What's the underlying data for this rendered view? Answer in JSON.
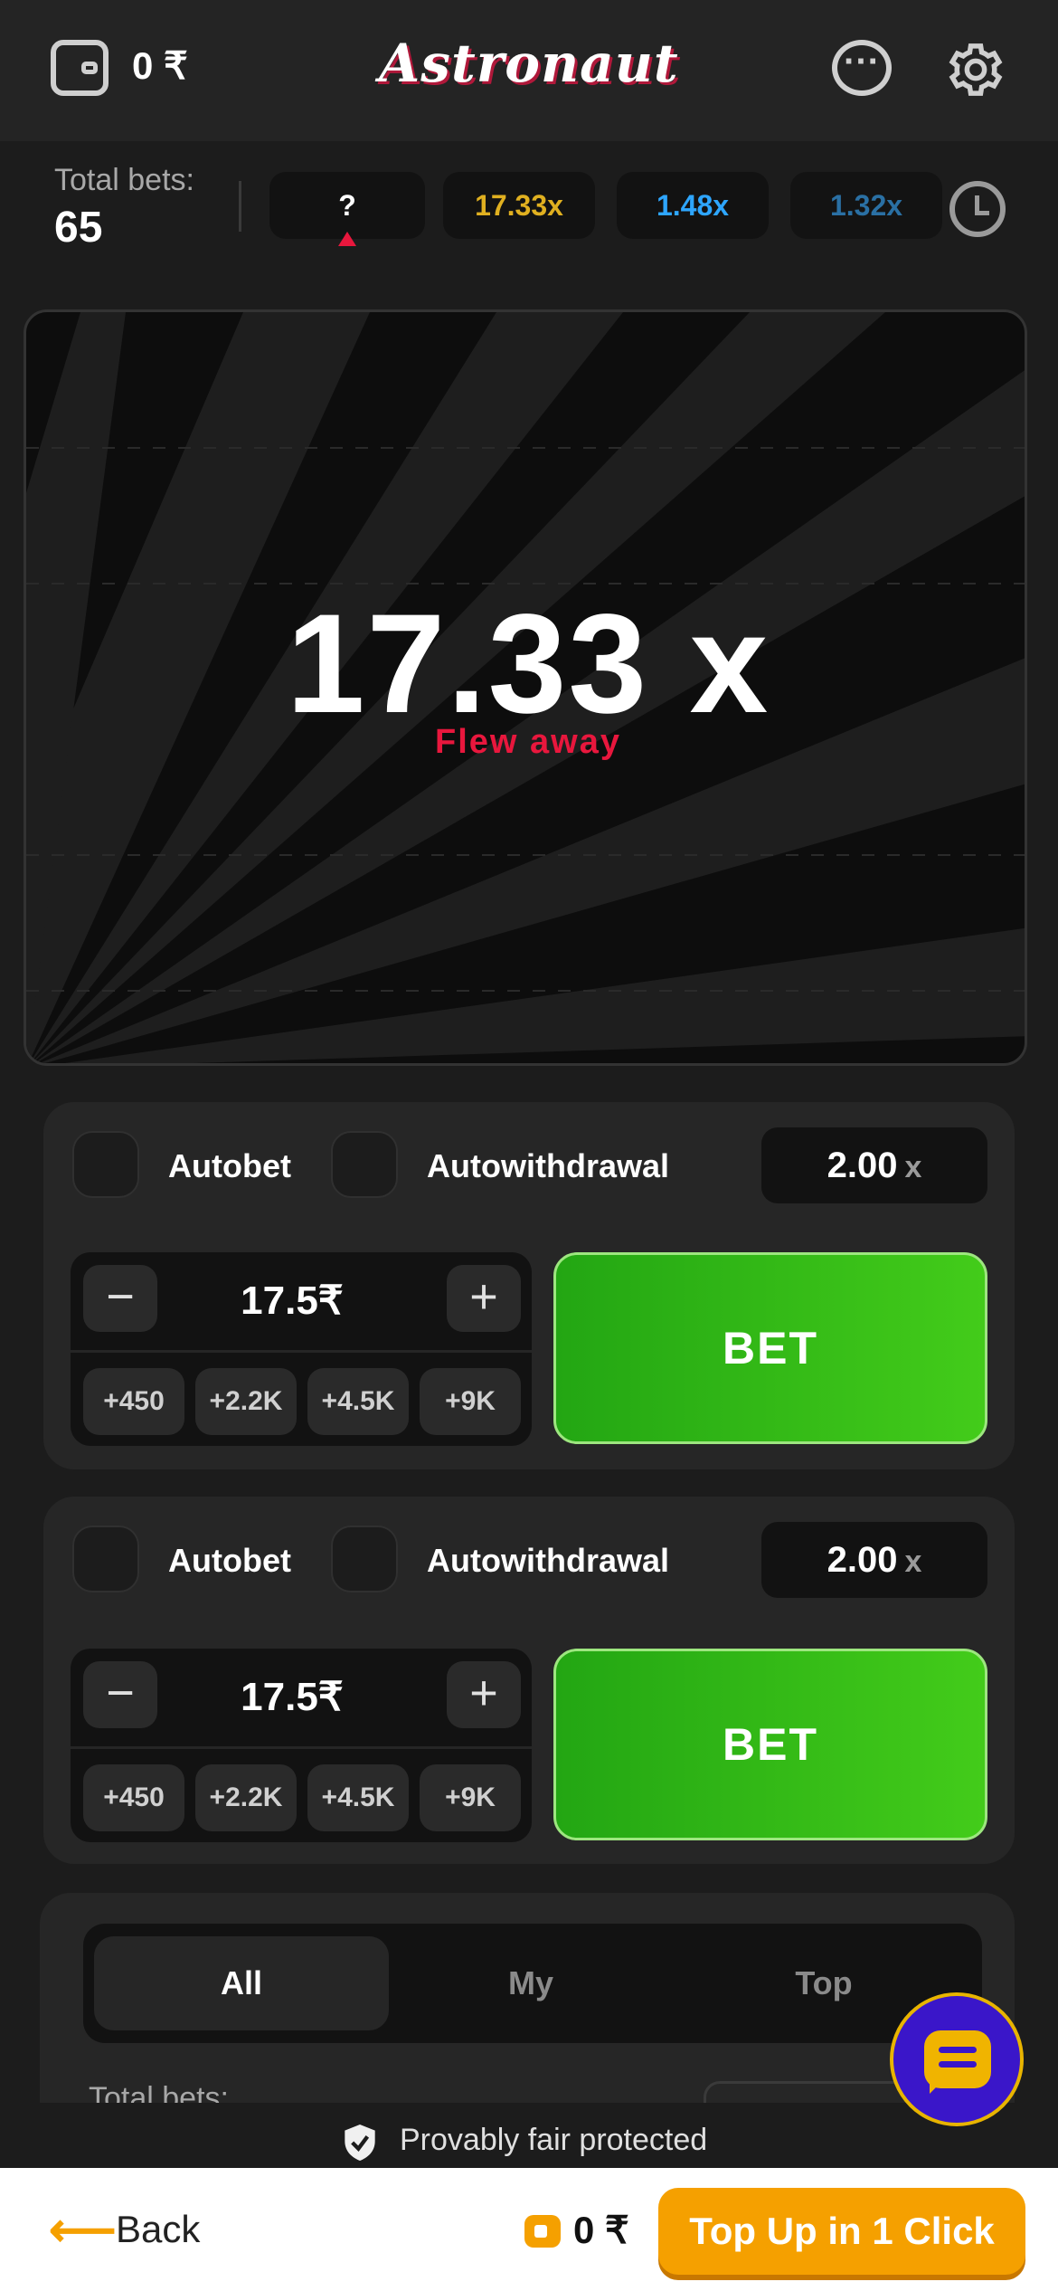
{
  "header": {
    "balance": "0 ₹",
    "logo": "Astronaut",
    "icons": {
      "wallet": "wallet-icon",
      "chat": "chat-icon",
      "settings": "gear-icon"
    }
  },
  "history": {
    "total_bets_label": "Total bets:",
    "total_bets_value": "65",
    "current": "?",
    "multipliers": [
      "17.33x",
      "1.48x",
      "1.32x"
    ],
    "colors": {
      "gold": "#e0b020",
      "blue": "#2ea6ff",
      "teal": "#2e86c7",
      "accent": "#e8173d"
    }
  },
  "game": {
    "multiplier": "17.33 x",
    "status": "Flew away"
  },
  "panels": [
    {
      "autobet_label": "Autobet",
      "autowithdrawal_label": "Autowithdrawal",
      "odds_value": "2.00",
      "odds_suffix": "x",
      "minus": "−",
      "plus": "+",
      "amount": "17.5₹",
      "quick": [
        "+450",
        "+2.2K",
        "+4.5K",
        "+9K"
      ],
      "bet_label": "BET"
    },
    {
      "autobet_label": "Autobet",
      "autowithdrawal_label": "Autowithdrawal",
      "odds_value": "2.00",
      "odds_suffix": "x",
      "minus": "−",
      "plus": "+",
      "amount": "17.5₹",
      "quick": [
        "+450",
        "+2.2K",
        "+4.5K",
        "+9K"
      ],
      "bet_label": "BET"
    }
  ],
  "bets_section": {
    "tabs": [
      "All",
      "My",
      "Top"
    ],
    "active_tab": "All",
    "total_bets_label": "Total bets:"
  },
  "fair": {
    "text": "Provably fair protected"
  },
  "bottom_bar": {
    "back_arrow": "⟵",
    "back_label": "Back",
    "balance": "0 ₹",
    "topup_label": "Top Up in 1 Click",
    "brand_color": "#f5a000"
  }
}
